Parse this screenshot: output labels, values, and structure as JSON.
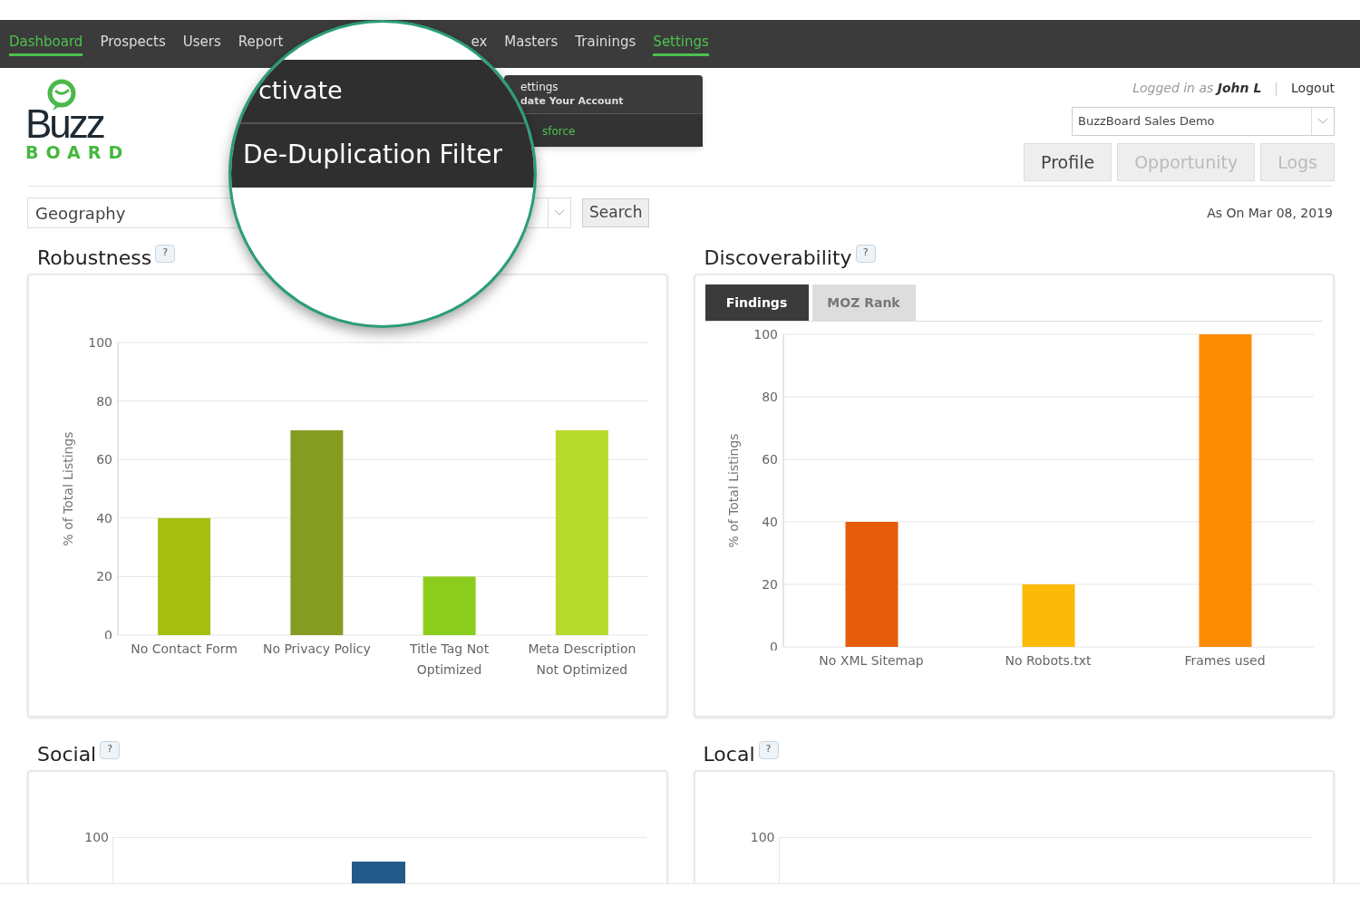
{
  "nav": [
    {
      "label": "Dashboard",
      "selected": true
    },
    {
      "label": "Prospects",
      "selected": false
    },
    {
      "label": "Users",
      "selected": false
    },
    {
      "label": "Report",
      "selected": false
    },
    {
      "label": "ex",
      "selected": false
    },
    {
      "label": "Masters",
      "selected": false
    },
    {
      "label": "Trainings",
      "selected": false
    },
    {
      "label": "Settings",
      "selected": true
    }
  ],
  "settings_menu": {
    "title": "ettings",
    "subtitle": "date Your Account",
    "item": "sforce"
  },
  "magnifier": {
    "items": [
      "ctivate",
      "De-Duplication Filter"
    ]
  },
  "logo": {
    "word": "Buzz",
    "sub": "BOARD"
  },
  "user": {
    "prefix": "Logged in as",
    "name": "John L",
    "separator": "|",
    "logout": "Logout"
  },
  "account_select": {
    "value": "BuzzBoard Sales Demo"
  },
  "view_tabs": [
    {
      "label": "Profile",
      "selected": true
    },
    {
      "label": "Opportunity",
      "selected": false
    },
    {
      "label": "Logs",
      "selected": false
    }
  ],
  "filter": {
    "value": "Geography",
    "button": "Search"
  },
  "as_on": "As On Mar 08, 2019",
  "panels": [
    {
      "title": "Robustness",
      "help": "?",
      "chart_data": {
        "type": "bar",
        "grid": true,
        "ylabel": "% of Total Listings",
        "categories": [
          "No Contact Form",
          "No Privacy Policy",
          "Title Tag Not Optimized",
          "Meta Description Not Optimized"
        ],
        "ylim": [
          0,
          100
        ],
        "yticks": [
          0,
          20,
          40,
          60,
          80,
          100
        ],
        "values": [
          40,
          70,
          20,
          70
        ],
        "colors": [
          "#a4bf0f",
          "#849c22",
          "#8ccc1c",
          "#b8da2a"
        ]
      }
    },
    {
      "title": "Discoverability",
      "help": "?",
      "tabs": [
        {
          "label": "Findings",
          "selected": true
        },
        {
          "label": "MOZ Rank",
          "selected": false
        }
      ],
      "chart_data": {
        "type": "bar",
        "grid": true,
        "ylabel": "% of Total Listings",
        "categories": [
          "No XML Sitemap",
          "No Robots.txt",
          "Frames used"
        ],
        "ylim": [
          0,
          100
        ],
        "yticks": [
          0,
          20,
          40,
          60,
          80,
          100
        ],
        "values": [
          40,
          20,
          100
        ],
        "colors": [
          "#e55d0a",
          "#fbba0a",
          "#fb8c04"
        ]
      }
    },
    {
      "title": "Social",
      "help": "?",
      "tick": "100",
      "bar": true
    },
    {
      "title": "Local",
      "help": "?",
      "tick": "100",
      "bar": false
    }
  ]
}
